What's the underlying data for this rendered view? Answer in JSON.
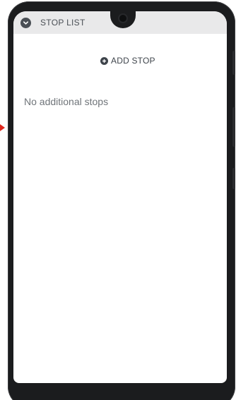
{
  "header": {
    "title": "STOP LIST",
    "toggle_icon": "chevron-down-icon"
  },
  "actions": {
    "add_stop_label": "ADD STOP",
    "add_stop_icon": "plus-circle-icon"
  },
  "stops": {
    "items": [],
    "empty_text": "No additional stops"
  },
  "colors": {
    "header_bg": "#e9e9ea",
    "text_dark": "#3e444b",
    "text_muted": "#6f7479",
    "device_frame": "#1b1c1e",
    "pointer": "#e0281e"
  }
}
